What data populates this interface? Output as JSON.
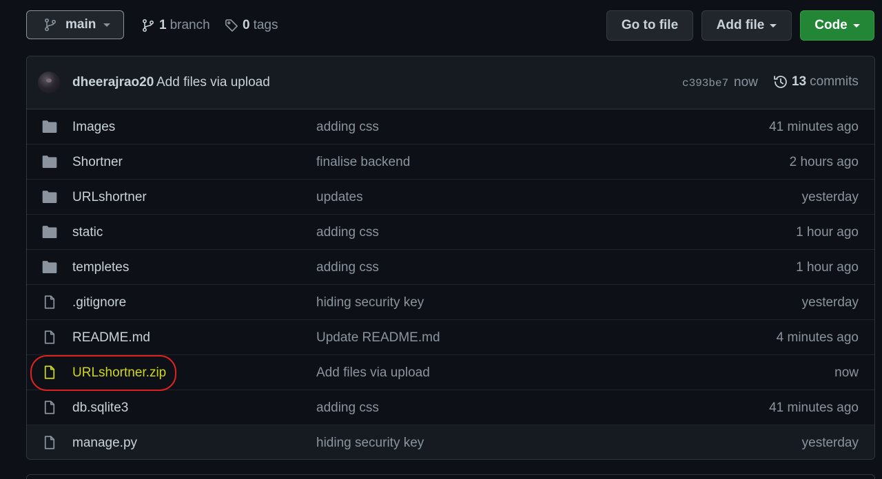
{
  "toolbar": {
    "branch_name": "main",
    "branches_count": "1",
    "branches_label": "branch",
    "tags_count": "0",
    "tags_label": "tags",
    "goto_file_label": "Go to file",
    "add_file_label": "Add file",
    "code_label": "Code"
  },
  "commit": {
    "author": "dheerajrao20",
    "message": "Add files via upload",
    "sha": "c393be7",
    "time": "now",
    "commits_count": "13",
    "commits_label": "commits"
  },
  "files": [
    {
      "type": "folder",
      "name": "Images",
      "message": "adding css",
      "time": "41 minutes ago"
    },
    {
      "type": "folder",
      "name": "Shortner",
      "message": "finalise backend",
      "time": "2 hours ago"
    },
    {
      "type": "folder",
      "name": "URLshortner",
      "message": "updates",
      "time": "yesterday"
    },
    {
      "type": "folder",
      "name": "static",
      "message": "adding css",
      "time": "1 hour ago"
    },
    {
      "type": "folder",
      "name": "templetes",
      "message": "adding css",
      "time": "1 hour ago"
    },
    {
      "type": "file",
      "name": ".gitignore",
      "message": "hiding security key",
      "time": "yesterday"
    },
    {
      "type": "file",
      "name": "README.md",
      "message": "Update README.md",
      "time": "4 minutes ago"
    },
    {
      "type": "file",
      "name": "URLshortner.zip",
      "message": "Add files via upload",
      "time": "now"
    },
    {
      "type": "file",
      "name": "db.sqlite3",
      "message": "adding css",
      "time": "41 minutes ago"
    },
    {
      "type": "file",
      "name": "manage.py",
      "message": "hiding security key",
      "time": "yesterday"
    }
  ],
  "colors": {
    "background": "#0d1117",
    "header_bg": "#161b22",
    "border": "#30363d",
    "primary_button": "#238636",
    "highlight_text": "#cfd61c",
    "annotation": "#e0221f"
  },
  "icons": {
    "branch": "git-branch-icon",
    "tag": "tag-icon",
    "history": "history-icon",
    "folder": "folder-icon",
    "file": "file-icon"
  }
}
